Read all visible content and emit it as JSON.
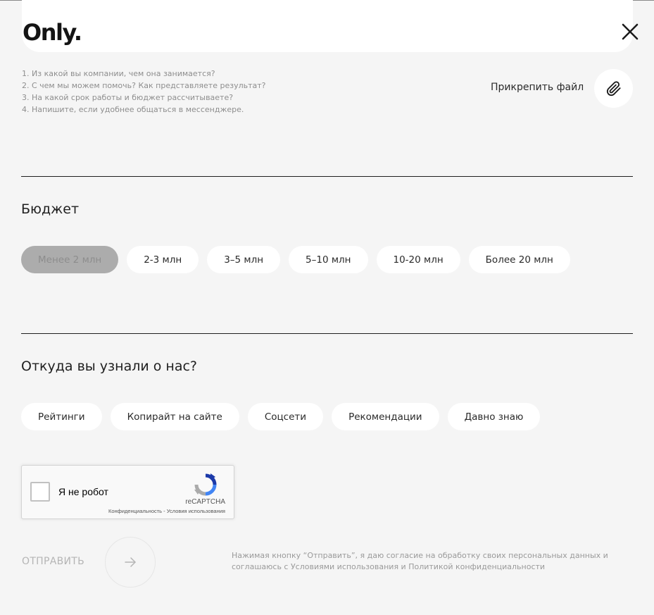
{
  "header": {
    "logo": "Only.",
    "close_icon": "close-icon"
  },
  "hints": [
    "1. Из какой вы компании, чем она занимается?",
    "2. С чем мы можем помочь? Как представляете результат?",
    "3. На какой срок работы и бюджет рассчитываете?",
    "4. Напишите, если удобнее общаться в мессенджере."
  ],
  "attach": {
    "label": "Прикрепить файл",
    "icon": "paperclip-icon"
  },
  "budget": {
    "title": "Бюджет",
    "options": [
      "Менее 2 млн",
      "2-3 млн",
      "3–5 млн",
      "5–10 млн",
      "10-20 млн",
      "Более 20 млн"
    ],
    "selected": "Менее 2 млн"
  },
  "source": {
    "title": "Откуда вы узнали о нас?",
    "options": [
      "Рейтинги",
      "Копирайт на сайте",
      "Соцсети",
      "Рекомендации",
      "Давно знаю"
    ]
  },
  "recaptcha": {
    "label": "Я не робот",
    "brand": "reCAPTCHA",
    "terms": "Конфиденциальность - Условия использования"
  },
  "submit": {
    "label": "ОТПРАВИТЬ",
    "icon": "arrow-right-icon"
  },
  "consent": "Нажимая кнопку “Отправить”, я даю согласие на обработку своих персональных данных и соглашаюсь с Условиями использования и Политикой конфиденциальности",
  "colors": {
    "background": "#f5f5f5",
    "chip": "#ffffff",
    "chip_selected": "#acacac",
    "text": "#1f1f1f",
    "muted": "#9a9a9a"
  }
}
